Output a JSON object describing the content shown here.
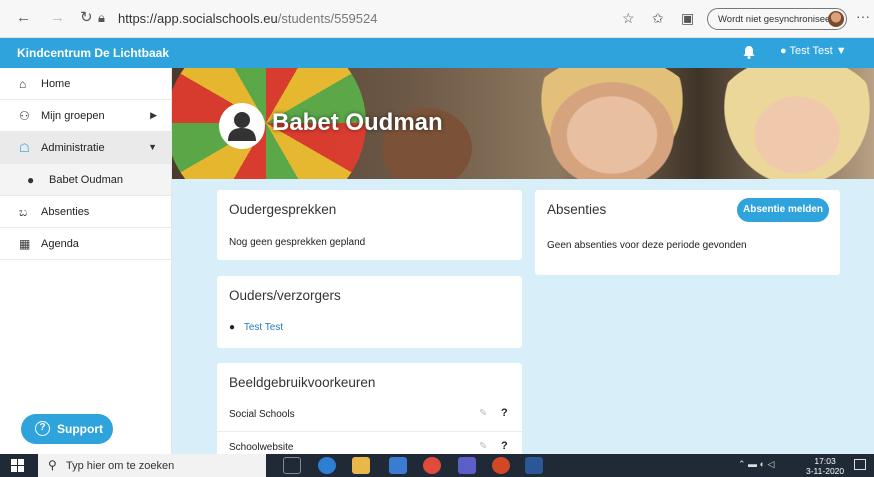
{
  "browser": {
    "url_host": "https://app.socialschools.eu",
    "url_path": "/students/559524",
    "sync_label": "Wordt niet gesynchroniseerd",
    "more_label": "···"
  },
  "header": {
    "brand": "Kindcentrum De Lichtbaak",
    "user": "Test Test"
  },
  "sidebar": {
    "items": [
      {
        "label": "Home",
        "icon": "home-icon"
      },
      {
        "label": "Mijn groepen",
        "icon": "groups-icon"
      },
      {
        "label": "Administratie",
        "icon": "admin-icon"
      },
      {
        "label": "Babet Oudman",
        "icon": "user-icon"
      },
      {
        "label": "Absenties",
        "icon": "stethoscope-icon"
      },
      {
        "label": "Agenda",
        "icon": "calendar-icon"
      }
    ],
    "support": "Support"
  },
  "student": {
    "name": "Babet Oudman"
  },
  "cards": {
    "oudergesprekken": {
      "title": "Oudergesprekken",
      "text": "Nog geen gesprekken gepland"
    },
    "ouders": {
      "title": "Ouders/verzorgers",
      "parent": "Test Test"
    },
    "beeldgebruik": {
      "title": "Beeldgebruikvoorkeuren",
      "rows": [
        {
          "name": "Social Schools",
          "help": "?"
        },
        {
          "name": "Schoolwebsite",
          "help": "?"
        }
      ]
    },
    "absenties": {
      "title": "Absenties",
      "button": "Absentie melden",
      "text": "Geen absenties voor deze periode gevonden"
    }
  },
  "taskbar": {
    "search_placeholder": "Typ hier om te zoeken",
    "time": "17:03",
    "date": "3-11-2020"
  },
  "colors": {
    "accent": "#2ea3dc",
    "content_bg": "#d8eef8",
    "link": "#2a7ab8"
  }
}
